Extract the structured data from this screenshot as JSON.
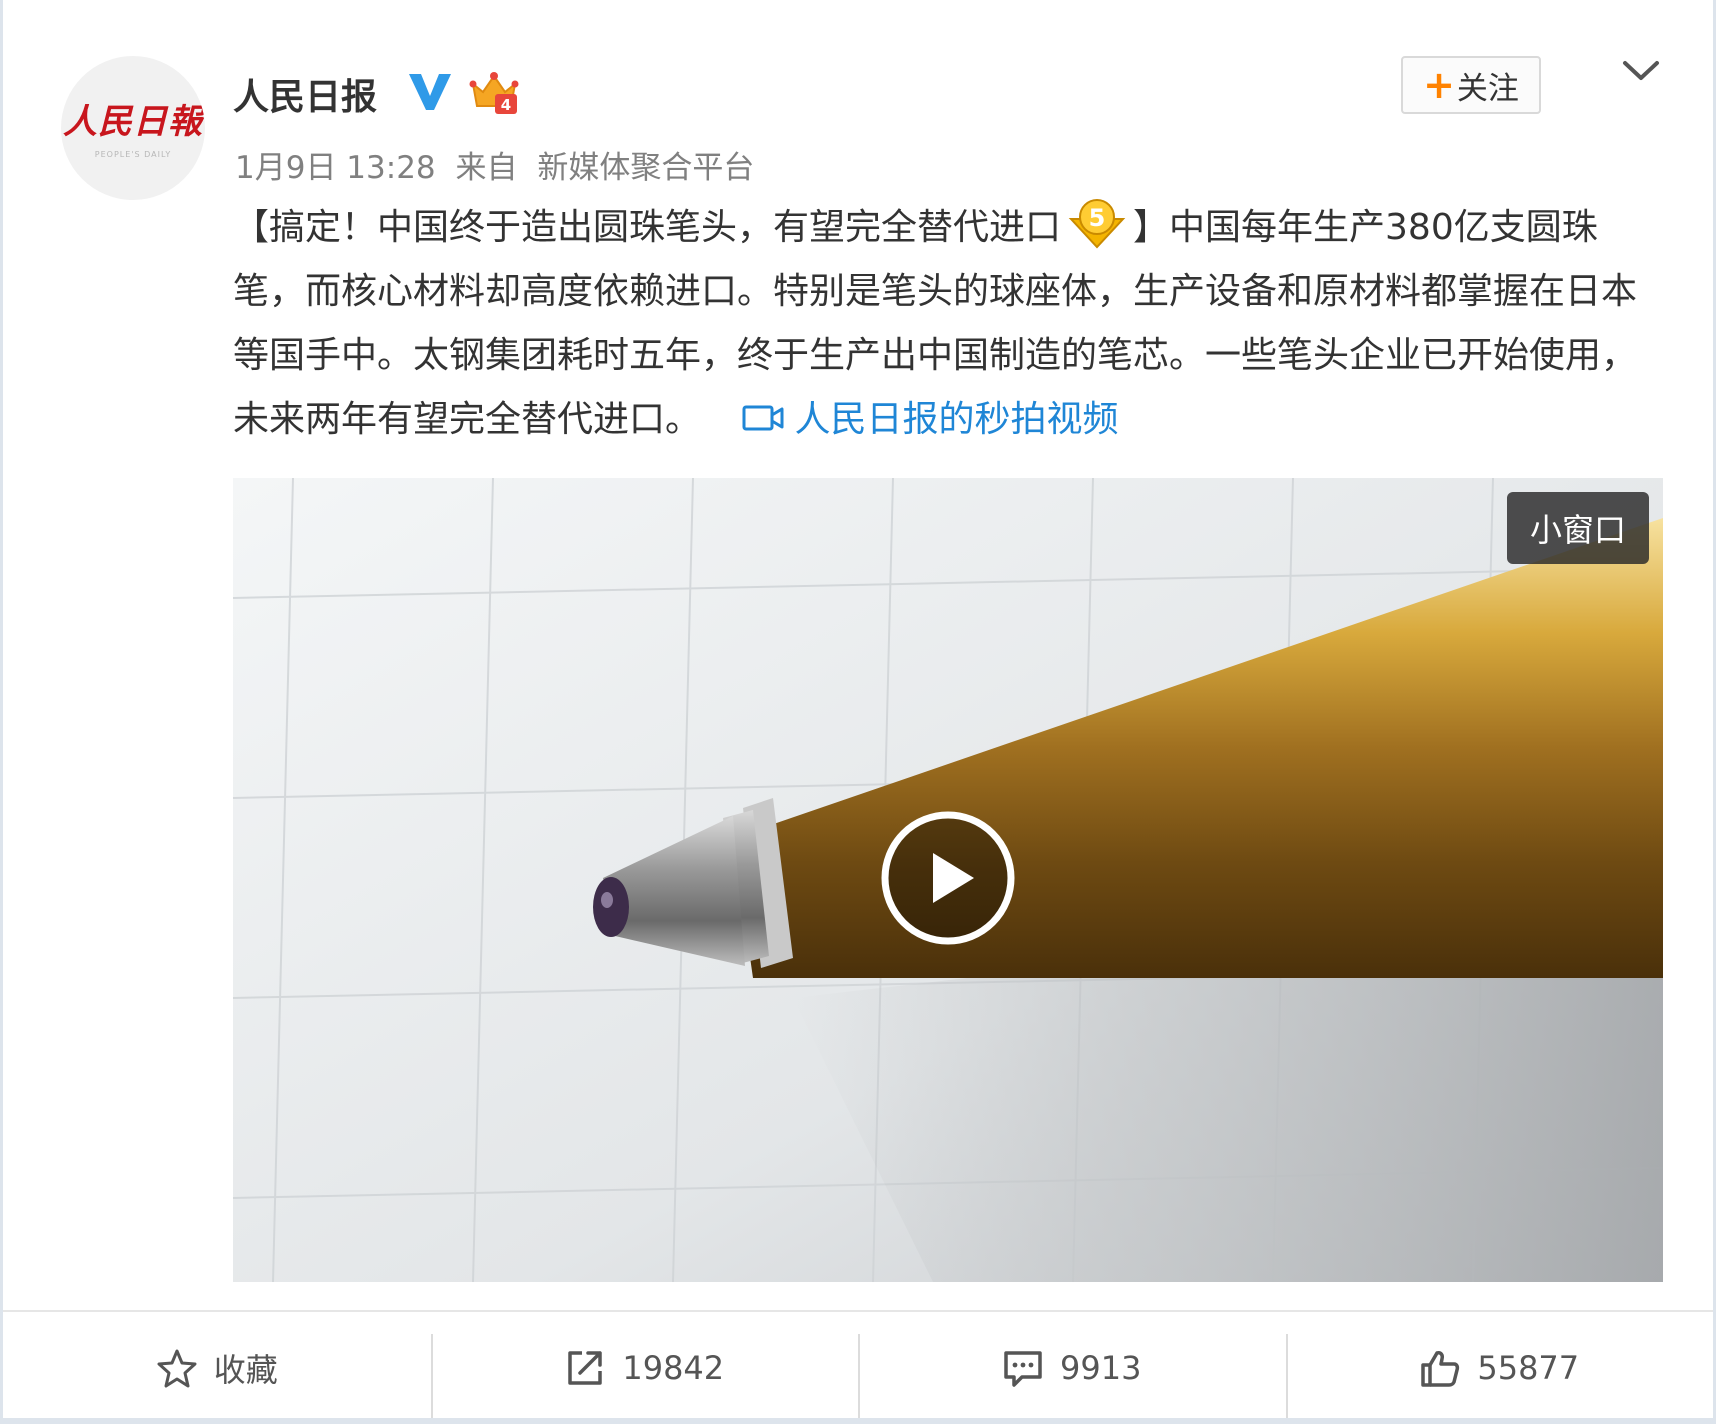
{
  "post": {
    "author": "人民日报",
    "avatar_text_cn": "人民日報",
    "avatar_text_en": "PEOPLE'S DAILY",
    "verified_icon": "verified-v-icon",
    "vip_icon": "crown-vip-icon",
    "date": "1月9日 13:28",
    "source_prefix": "来自",
    "source": "新媒体聚合平台",
    "follow_plus": "+",
    "follow_label": "关注",
    "text_part1": "【搞定！中国终于造出圆珠笔头，有望完全替代进口",
    "text_part2": "】中国每年生产380亿支圆珠笔，而核心材料却高度依赖进口。特别是笔头的球座体，生产设备和原材料都掌握在日本等国手中。太钢集团耗时五年，终于生产出中国制造的笔芯。一些笔头企业已开始使用，未来两年有望完全替代进口。",
    "video_link_text": "人民日报的秒拍视频",
    "emoji_name": "gold-medal-5-emoji"
  },
  "video": {
    "mini_window_label": "小窗口",
    "play_icon": "play-icon"
  },
  "actions": {
    "favorite_label": "收藏",
    "repost_count": "19842",
    "comment_count": "9913",
    "like_count": "55877"
  },
  "colors": {
    "accent_orange": "#ff8200",
    "link_blue": "#1f86d6",
    "verified_blue": "#2f9ae8",
    "crown_gold": "#f5a623"
  }
}
